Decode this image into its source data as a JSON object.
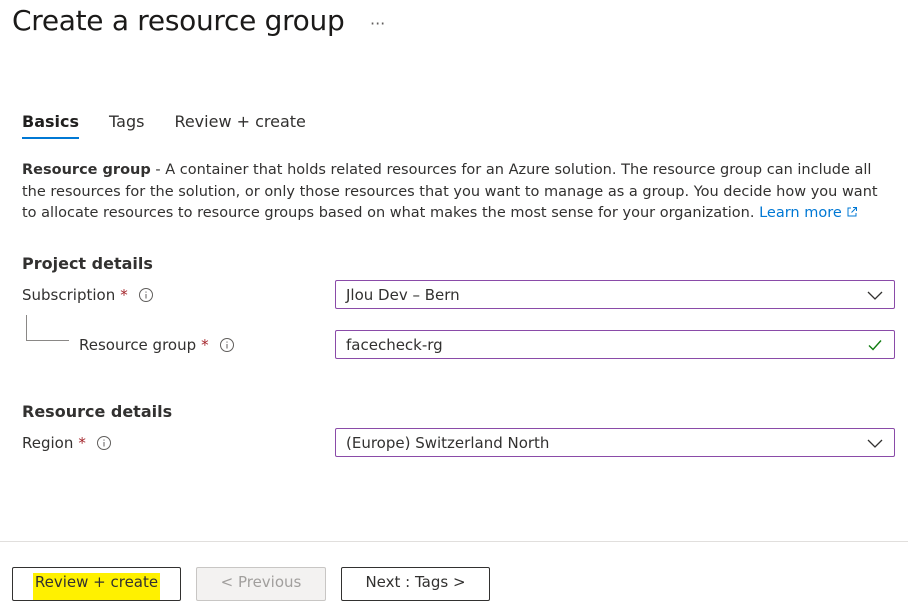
{
  "page": {
    "title": "Create a resource group",
    "more_label": "···"
  },
  "tabs": [
    {
      "label": "Basics",
      "active": true
    },
    {
      "label": "Tags",
      "active": false
    },
    {
      "label": "Review + create",
      "active": false
    }
  ],
  "description": {
    "term": "Resource group",
    "text": " - A container that holds related resources for an Azure solution. The resource group can include all the resources for the solution, or only those resources that you want to manage as a group. You decide how you want to allocate resources to resource groups based on what makes the most sense for your organization. ",
    "link_label": "Learn more",
    "link_icon": "external-link-icon"
  },
  "project_details": {
    "heading": "Project details",
    "subscription": {
      "label": "Subscription",
      "required_mark": "*",
      "value": "Jlou Dev – Bern",
      "icon": "chevron-down-icon"
    },
    "resource_group": {
      "label": "Resource group",
      "required_mark": "*",
      "value": "facecheck-rg",
      "icon": "checkmark-icon"
    }
  },
  "resource_details": {
    "heading": "Resource details",
    "region": {
      "label": "Region",
      "required_mark": "*",
      "value": "(Europe) Switzerland North",
      "icon": "chevron-down-icon"
    }
  },
  "footer": {
    "review_create_label": "Review + create",
    "previous_label": "< Previous",
    "next_label": "Next : Tags >"
  },
  "colors": {
    "accent": "#0078d4",
    "field_border": "#8a4ba8",
    "required": "#a4262c",
    "success": "#107c10",
    "highlight": "#fff100"
  }
}
